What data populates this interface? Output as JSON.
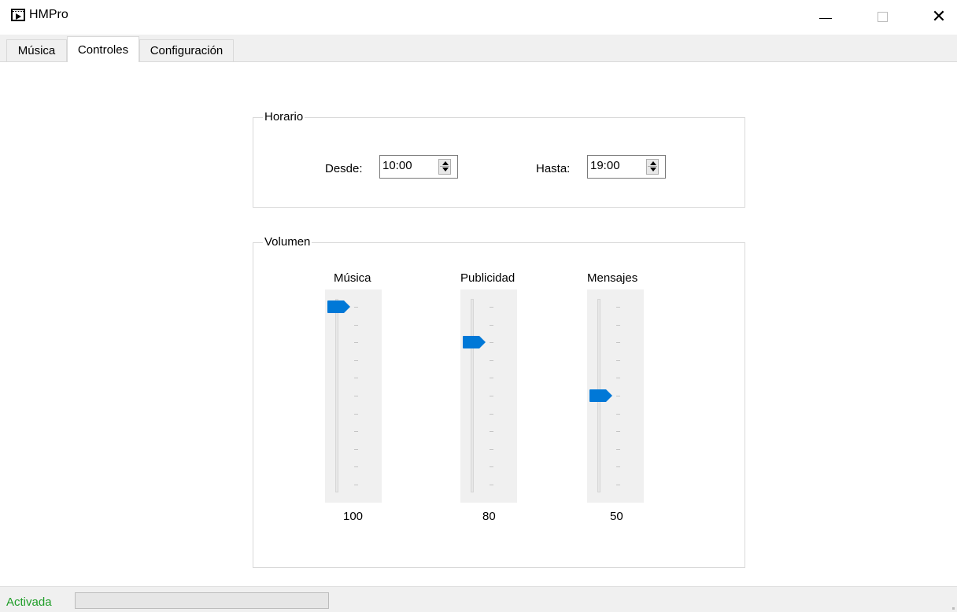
{
  "window": {
    "title": "HMPro"
  },
  "tabs": [
    {
      "label": "Música"
    },
    {
      "label": "Controles"
    },
    {
      "label": "Configuración"
    }
  ],
  "active_tab": "Controles",
  "horario": {
    "legend": "Horario",
    "desde_label": "Desde:",
    "desde_value": "10:00",
    "hasta_label": "Hasta:",
    "hasta_value": "19:00"
  },
  "volumen": {
    "legend": "Volumen",
    "sliders": [
      {
        "title": "Música",
        "value": "100",
        "level": 100
      },
      {
        "title": "Publicidad",
        "value": "80",
        "level": 80
      },
      {
        "title": "Mensajes",
        "value": "50",
        "level": 50
      }
    ]
  },
  "status": {
    "text": "Activada",
    "progress_fraction": 0
  },
  "colors": {
    "accent": "#0078d7",
    "status_text": "#1e9d27"
  }
}
